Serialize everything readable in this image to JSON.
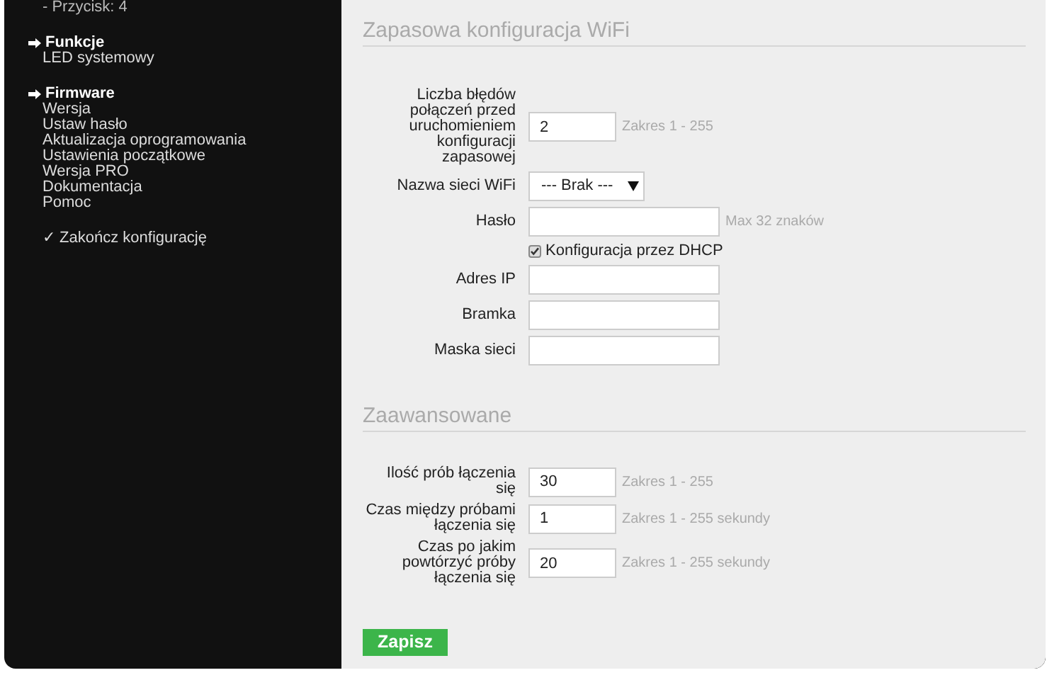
{
  "sidebar": {
    "top_item": "- Przycisk: 4",
    "groups": [
      {
        "title": "Funkcje",
        "items": [
          "LED systemowy"
        ]
      },
      {
        "title": "Firmware",
        "items": [
          "Wersja",
          "Ustaw hasło",
          "Aktualizacja oprogramowania",
          "Ustawienia początkowe",
          "Wersja PRO",
          "Dokumentacja",
          "Pomoc"
        ]
      }
    ],
    "finish": "✓ Zakończ konfigurację"
  },
  "sections": [
    {
      "title": "Zapasowa konfiguracja WiFi",
      "fields": [
        {
          "kind": "number",
          "label": "Liczba błędów połączeń przed uruchomieniem konfiguracji zapasowej",
          "value": "2",
          "hint": "Zakres 1 - 255"
        },
        {
          "kind": "select",
          "label": "Nazwa sieci WiFi",
          "value": "--- Brak ---"
        },
        {
          "kind": "text",
          "label": "Hasło",
          "hint": "Max 32 znaków"
        },
        {
          "kind": "checkbox",
          "label": "Konfiguracja przez DHCP",
          "checked": true
        },
        {
          "kind": "text",
          "label": "Adres IP"
        },
        {
          "kind": "text",
          "label": "Bramka"
        },
        {
          "kind": "text",
          "label": "Maska sieci"
        }
      ]
    },
    {
      "title": "Zaawansowane",
      "fields": [
        {
          "kind": "number",
          "label": "Ilość prób łączenia się",
          "value": "30",
          "hint": "Zakres 1 - 255"
        },
        {
          "kind": "number",
          "label": "Czas między próbami łączenia się",
          "value": "1",
          "hint": "Zakres 1 - 255 sekundy"
        },
        {
          "kind": "number",
          "label": "Czas po jakim powtórzyć próby łączenia się",
          "value": "20",
          "hint": "Zakres 1 - 255 sekundy"
        }
      ]
    }
  ],
  "save_button": "Zapisz"
}
